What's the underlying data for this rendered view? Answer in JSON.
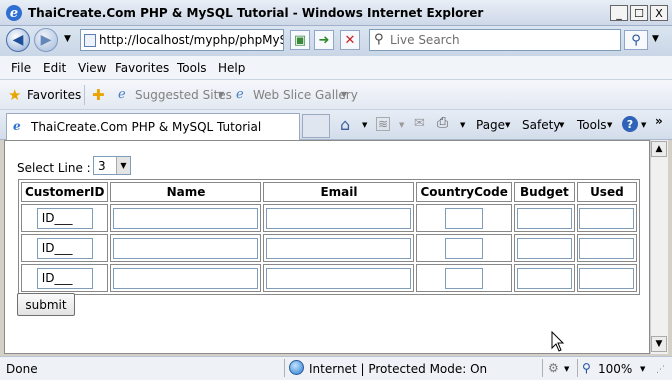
{
  "window": {
    "title": "ThaiCreate.Com PHP & MySQL Tutorial - Windows Internet Explorer",
    "minimize": "_",
    "restore": "☐",
    "close": "X"
  },
  "navigation": {
    "address": "http://localhost/myphp/phpMySQ",
    "search_placeholder": "Live Search"
  },
  "menu": [
    "File",
    "Edit",
    "View",
    "Favorites",
    "Tools",
    "Help"
  ],
  "favorites_bar": {
    "favorites_label": "Favorites",
    "suggested_sites": "Suggested Sites",
    "web_slice_gallery": "Web Slice Gallery"
  },
  "tab": {
    "title": "ThaiCreate.Com PHP & MySQL Tutorial"
  },
  "command_bar": {
    "page": "Page",
    "safety": "Safety",
    "tools": "Tools",
    "help": "?"
  },
  "form": {
    "select_label": "Select Line :",
    "select_value": "3",
    "columns": [
      "CustomerID",
      "Name",
      "Email",
      "CountryCode",
      "Budget",
      "Used"
    ],
    "rows": [
      {
        "customer_id": "ID___",
        "name": "",
        "email": "",
        "country_code": "",
        "budget": "",
        "used": ""
      },
      {
        "customer_id": "ID___",
        "name": "",
        "email": "",
        "country_code": "",
        "budget": "",
        "used": ""
      },
      {
        "customer_id": "ID___",
        "name": "",
        "email": "",
        "country_code": "",
        "budget": "",
        "used": ""
      }
    ],
    "submit_label": "submit"
  },
  "status": {
    "text": "Done",
    "zone": "Internet | Protected Mode: On",
    "zoom": "100%"
  }
}
